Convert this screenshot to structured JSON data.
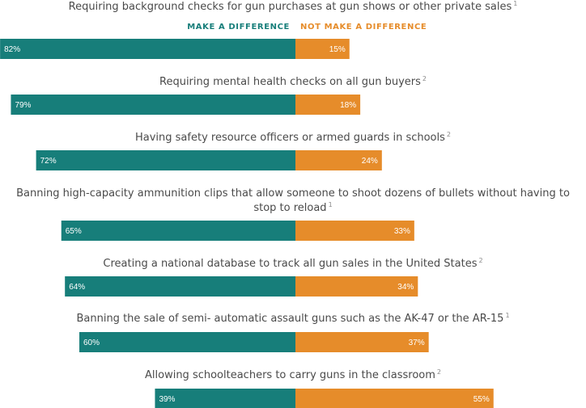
{
  "colors": {
    "make": "#177e7a",
    "not_make": "#e68c2a"
  },
  "chart_data": {
    "type": "bar",
    "orientation": "horizontal-diverging",
    "legend": [
      "MAKE A DIFFERENCE",
      "NOT MAKE A DIFFERENCE"
    ],
    "legend_position": "top-center",
    "xlim": [
      -100,
      100
    ],
    "grid": false,
    "categories": [
      {
        "lines": [
          "Requiring background checks for gun purchases at gun shows or other private sales"
        ],
        "note": "1"
      },
      {
        "lines": [
          "Requiring mental health checks on all gun buyers"
        ],
        "note": "2"
      },
      {
        "lines": [
          "Having safety resource officers or armed guards in schools"
        ],
        "note": "2"
      },
      {
        "lines": [
          "Banning high-capacity ammunition clips that allow someone to shoot dozens of bullets without having to",
          "stop to reload"
        ],
        "note": "1"
      },
      {
        "lines": [
          "Creating a national database to track all gun sales in the United States"
        ],
        "note": "2"
      },
      {
        "lines": [
          "Banning the sale of semi- automatic assault guns such as the AK-47 or the AR-15"
        ],
        "note": "1"
      },
      {
        "lines": [
          "Allowing schoolteachers to carry guns in the classroom"
        ],
        "note": "2"
      }
    ],
    "series": [
      {
        "name": "MAKE A DIFFERENCE",
        "values": [
          82,
          79,
          72,
          65,
          64,
          60,
          39
        ]
      },
      {
        "name": "NOT MAKE A DIFFERENCE",
        "values": [
          15,
          18,
          24,
          33,
          34,
          37,
          55
        ]
      }
    ]
  }
}
